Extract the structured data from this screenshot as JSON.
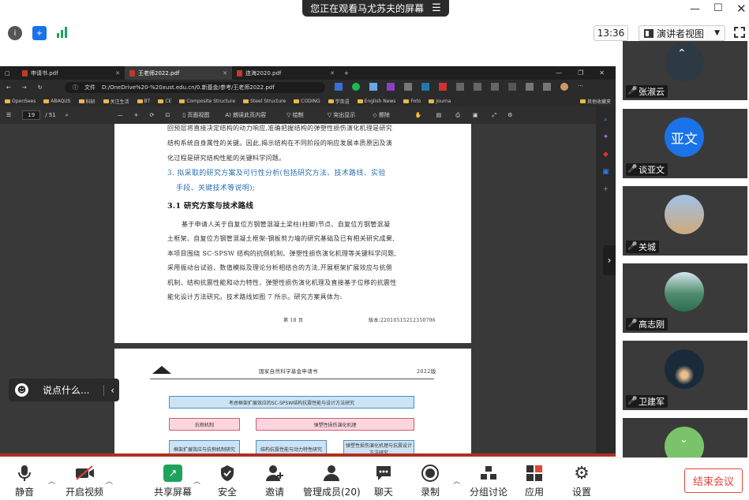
{
  "banner": {
    "text": "您正在观看马尤苏夫的屏幕"
  },
  "topbar": {
    "time": "13:36",
    "view_label": "演讲者视图"
  },
  "browser": {
    "tabs": [
      {
        "label": "申请书.pdf"
      },
      {
        "label": "王老师2022.pdf"
      },
      {
        "label": "连海2020.pdf"
      }
    ],
    "file_label": "文件",
    "url": "D:/OneDrive%20-%20xust.edu.cn/0.新基金/参考/王老师2022.pdf",
    "bookmarks": [
      "OpenSees",
      "ABAQUS",
      "科研",
      "关注生活",
      "BT",
      "CE",
      "Composite Structure",
      "Steel Structure",
      "CODING",
      "学英语",
      "English News",
      "Foto",
      "Journa",
      "其他收藏夹"
    ],
    "pdf_toolbar": {
      "page_current": "19",
      "page_total": "/ 51",
      "page_view": "页面视图",
      "read_aloud": "朗读此页内容",
      "draw": "绘制",
      "highlight": "突出显示",
      "erase": "擦除"
    }
  },
  "document": {
    "page1_lines": [
      "回预层将直接决定结构的动力响应,准确把握结构的弹塑性损伤演化机理是研究",
      "结构系统自身属性的关键。因此,揭示结构在不同阶段的响应发展本质原因及演",
      "化过程是研究结构性能的关键科学问题。"
    ],
    "section3_title": "3. 拟采取的研究方案及可行性分析(包括研究方法、技术路线、实验",
    "section3_title2": "手段、关键技术等说明);",
    "section31_title": "3.1  研究方案与技术路线",
    "para_lines": [
      "基于申请人关于自复位方钢管混凝土梁柱(柱脚)节点、自复位方钢管混凝",
      "土框架、自复位方钢管混凝土框架-钢板剪力墙的研究基础及已有相关研究成果,",
      "本项目围绕 SC-SPSW 结构的抗侧机制、弹塑性损伤演化机理等关键科学问题,",
      "采用振动台试验、数值模拟及理论分析相结合的方法,开展框架扩展效应与抗侧",
      "机制、结构抗震性能和动力特性、弹塑性损伤演化机理及直接基于位移的抗震性",
      "能化设计方法研究。技术路线如图 7 所示。研究方案具体为:"
    ],
    "footer_left": "第 18 页",
    "footer_right": "版本:22010515212350796",
    "page2_header": "国家自然科学基金申请书",
    "page2_year": "2022版",
    "flow_top": "考虑框架扩展效应的SC-SPSW结构抗震性能与设计方法研究",
    "flow_mid_left": "抗侧机制",
    "flow_mid_right": "弹塑性损伤演化机理",
    "flow_bot_1": "框架扩展效应与抗侧机制研究",
    "flow_bot_2": "结构抗震性能与动力特性研究",
    "flow_bot_3": "弹塑性损伤演化机理与抗震设计方法研究"
  },
  "participants": [
    {
      "name": "",
      "avatar_color": "#2d3a44"
    },
    {
      "name": "张淑云",
      "avatar_color": "#555"
    },
    {
      "name": "谈亚文",
      "avatar_text": "亚文",
      "avatar_color": "#1a73e8"
    },
    {
      "name": "关城",
      "avatar_color": "#8fb4d9"
    },
    {
      "name": "高志刚",
      "avatar_color": "#4f8c6a"
    },
    {
      "name": "卫建军",
      "avatar_color": "#1b2a3a"
    },
    {
      "name": "",
      "avatar_color": "#7ac36a"
    }
  ],
  "chat": {
    "placeholder": "说点什么..."
  },
  "toolbar": {
    "mute": "静音",
    "video": "开启视频",
    "share": "共享屏幕",
    "security": "安全",
    "invite": "邀请",
    "manage": "管理成员(20)",
    "chat": "聊天",
    "record": "录制",
    "breakout": "分组讨论",
    "apps": "应用",
    "settings": "设置",
    "end": "结束会议"
  },
  "colors": {
    "accent": "#1a73e8",
    "end_red": "#e0453a",
    "share_green": "#1fa35b"
  }
}
